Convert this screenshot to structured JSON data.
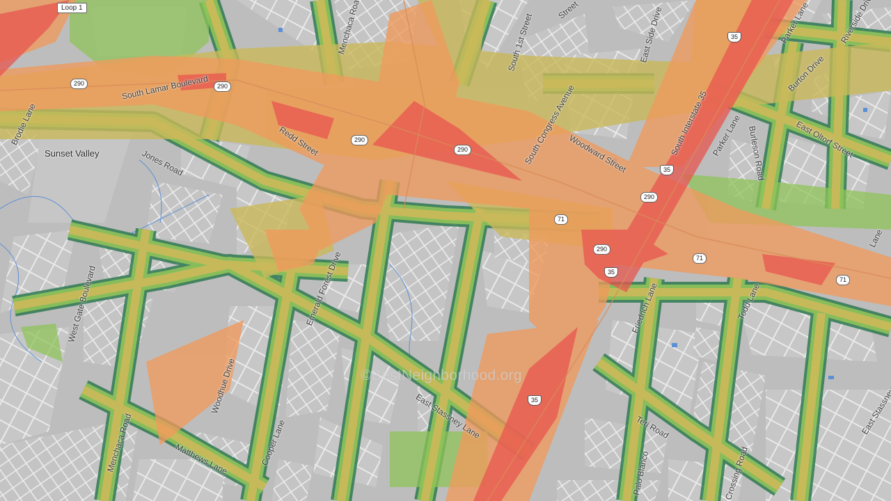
{
  "map": {
    "colors": {
      "background": "#bdbdbd",
      "block_light": "#d8d8d8",
      "street_white": "#ffffff",
      "water": "#5b8fd6",
      "score_high": "#e8564f",
      "score_mid_high": "#f09a5c",
      "score_mid": "#c9b95a",
      "score_low": "#8fc45a",
      "score_lowest": "#2f7a52"
    },
    "labels": {
      "loop1": "Loop 1",
      "menchaca_road_top": "Menchaca Road",
      "south_1st_street": "South 1st Street",
      "east_side_drive": "East Side Drive",
      "riverside_drive": "Riverside Drive",
      "parker_lane_top": "Parker Lane",
      "burton_drive": "Burton Drive",
      "south_lamar": "South Lamar Boulevard",
      "brodie_lane": "Brodie Lane",
      "redd_street": "Redd Street",
      "south_congress": "South Congress Avenue",
      "woodward_street": "Woodward Street",
      "south_interstate_35": "South Interstate 35",
      "parker_lane": "Parker Lane",
      "burleson_road": "Burleson Road",
      "east_oltorf": "East Oltorf Street",
      "sunset_valley": "Sunset Valley",
      "jones_road": "Jones Road",
      "west_gate": "West Gate Boulevard",
      "emerald_forest": "Emerald Forest Drive",
      "friedrich_lane": "Friedrich Lane",
      "todd_lane": "Todd Lane",
      "woodhue_drive": "Woodhue Drive",
      "east_stassney": "East Stassney Lane",
      "menchaca_road": "Menchaca Road",
      "cooper_lane": "Cooper Lane",
      "matthews_lane": "Matthews Lane",
      "teri_road": "Teri Road",
      "palo_blanco": "Palo Blanco",
      "crossing_road": "Crossing Road",
      "east_stassney_right": "East Stassney",
      "lane_fragment": "Lane",
      "street_fragment": "Street"
    },
    "shields": {
      "us290_a": "290",
      "us290_b": "290",
      "us290_c": "290",
      "us290_d": "290",
      "us290_e": "290",
      "us290_f": "290",
      "i35_a": "35",
      "i35_b": "35",
      "i35_c": "35",
      "i35_d": "35",
      "tx71_a": "71",
      "tx71_b": "71",
      "tx71_c": "71"
    },
    "watermark": "©BestNeighborhood.org"
  }
}
